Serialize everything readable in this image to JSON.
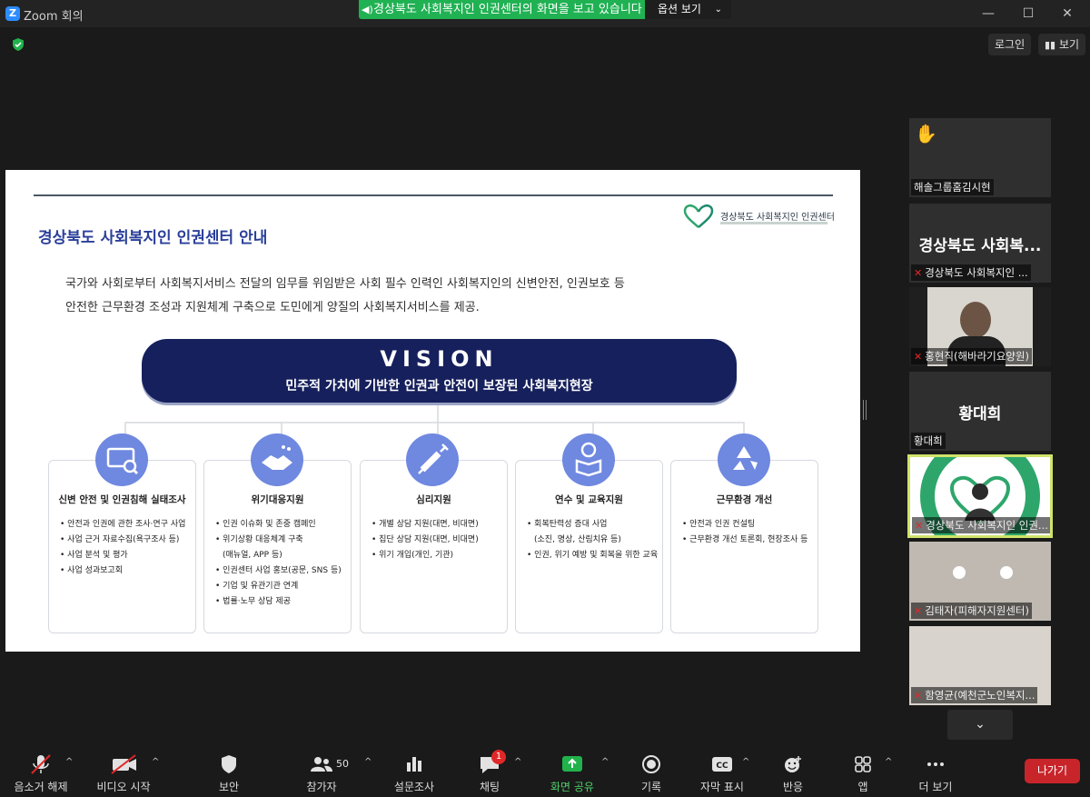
{
  "window": {
    "title": "Zoom 회의",
    "share_banner": "경상북도 사회복지인 인권센터의 화면을 보고 있습니다",
    "options_label": "옵션 보기",
    "login_label": "로그인",
    "view_label": "보기"
  },
  "slide": {
    "heading": "경상북도 사회복지인 인권센터 안내",
    "logo_text": "경상북도 사회복지인 인권센터",
    "intro_line1": "국가와 사회로부터 사회복지서비스 전달의 임무를 위임받은 사회 필수 인력인 사회복지인의 신변안전, 인권보호 등",
    "intro_line2": "안전한 근무환경 조성과 지원체계 구축으로 도민에게 양질의 사회복지서비스를 제공.",
    "vision_title": "VISION",
    "vision_sub": "민주적 가치에 기반한 인권과 안전이 보장된 사회복지현장",
    "cards": [
      {
        "title": "신변 안전 및 인권침해 실태조사",
        "items": [
          "안전과 인권에 관한 조사·연구 사업",
          "사업 근거 자료수집(욕구조사 등)",
          "사업 분석 및 평가",
          "사업 성과보고회"
        ]
      },
      {
        "title": "위기대응지원",
        "items": [
          "인권 이슈화 및 존중 캠페인",
          "위기상황 대응체계 구축",
          "(매뉴얼, APP 등)",
          "인권센터 사업 홍보(공문, SNS 등)",
          "기업 및 유관기관 연계",
          "법률·노무 상담 제공"
        ]
      },
      {
        "title": "심리지원",
        "items": [
          "개별 상담 지원(대면, 비대면)",
          "집단 상담 지원(대면, 비대면)",
          "위기 개입(개인, 기관)"
        ]
      },
      {
        "title": "연수 및 교육지원",
        "items": [
          "회복탄력성 증대 사업",
          "(소진, 명상, 산림치유 등)",
          "인권, 위기 예방 및 회복을 위한 교육"
        ]
      },
      {
        "title": "근무환경 개선",
        "items": [
          "안전과 인권 컨설팅",
          "근무환경 개선 토론회, 현장조사 등"
        ]
      }
    ]
  },
  "participants": [
    {
      "name": "해솔그룹홈김시현",
      "hand_raised": true
    },
    {
      "name": "경상북도 사회복지인 ...",
      "big": "경상북도 사회복...",
      "muted": true
    },
    {
      "name": "홍현직(해바라기요양원)",
      "muted": true
    },
    {
      "name": "황대희",
      "big": "황대희"
    },
    {
      "name": "경상북도 사회복지인 인권...",
      "muted": true,
      "speaking": true
    },
    {
      "name": "김태자(피해자지원센터)",
      "muted": true
    },
    {
      "name": "함영균(예천군노인복지...",
      "muted": true
    }
  ],
  "toolbar": {
    "unmute": "음소거 해제",
    "start_video": "비디오 시작",
    "security": "보안",
    "participants": "참가자",
    "participant_count": "50",
    "polls": "설문조사",
    "chat": "채팅",
    "chat_badge": "1",
    "share_screen": "화면 공유",
    "record": "기록",
    "captions": "자막 표시",
    "reactions": "반응",
    "apps": "앱",
    "more": "더 보기",
    "leave": "나가기"
  },
  "colors": {
    "share_green": "#20b153",
    "vision_navy": "#16205c",
    "icon_blue": "#6f88e0",
    "heading_blue": "#2a3f9a",
    "leave_red": "#c8252b",
    "speaking_border": "#cfe46a"
  },
  "icons": {
    "card_icons": [
      "monitor-search-icon",
      "handshake-icon",
      "syringe-icon",
      "person-book-icon",
      "recycle-icon"
    ]
  }
}
